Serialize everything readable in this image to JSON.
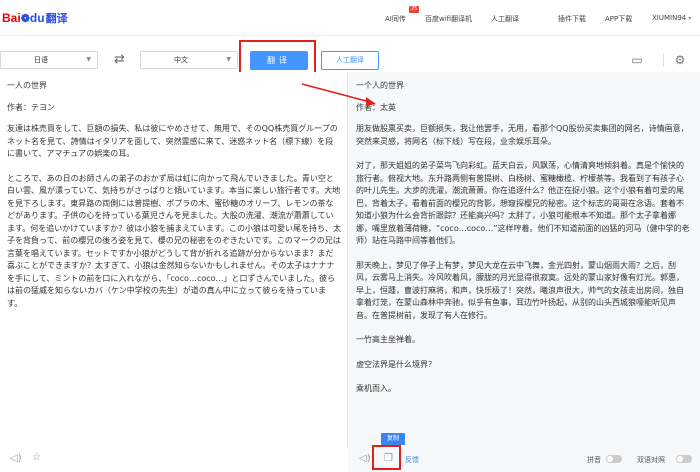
{
  "header": {
    "logo_bai": "Bai",
    "logo_du": "du",
    "logo_suffix": "翻译",
    "nav": [
      {
        "label": "AI同传"
      },
      {
        "label": "百度wifi翻译机"
      },
      {
        "label": "人工翻译"
      },
      {
        "label": "插件下载"
      },
      {
        "label": "APP下载"
      },
      {
        "label": "XIUMIN94"
      }
    ],
    "badge": "25"
  },
  "toolbar": {
    "source_lang": "日语",
    "target_lang": "中文",
    "translate_label": "翻译",
    "human_label": "人工翻译"
  },
  "source": {
    "paragraphs": [
      "一人の世界",
      "作者：テヨン",
      "友達は株売買をして、巨額の損失、私は彼にやめさせて、無用で、そのQQ株売買グループのネット名を見て、詩情はイタリアを面して、突然霊感に来て、迷惑ネット名（標下線）を段に書いて、アマチュアの娯楽の耳。",
      "ところで、あの日のお師さんの弟子のおかず局は虹に向かって飛んでいきました。青い空と白い雲、風が漂っていて、気持ちがさっぱりと傾いています。本当に楽しい旅行者です。大地を見下ろします。東昇路の両側には普提樹、ポプラの木、蜜砂糖のオリーブ、レモンの茶などがあります。子供の心を持っている葉児さんを見ました。大股の洗濯、潮流が蕭蕭しています。何を追いかけていますか？彼は小狼を捕まえています。この小狼は可愛い尾を持ち、太子を背負って、前の櫻兄の後ろ姿を見て、櫻の兄の秘密をのぞきたいです。このマークの兄は言葉を唱えています。セットですか小狼がどうして背が折れる追跡が分からないまま？まだ喜ぶことができますか？太すぎて、小狼は金然知らないかもしれません。その太子はナナナを手にして、ミントの前を口に入れながら、「coco…coco…」と口ずさんでいました。彼らは前の猛威を知らないカバ（ケン中学校の先生）が道の真ん中に立って彼らを待っています。"
    ]
  },
  "result": {
    "paragraphs": [
      "一个人的世界",
      "作者：太英",
      "朋友做股票买卖，巨额损失，我让他罢手，无用，看那个QQ股份买卖集团的网名，诗情画意，突然来灵感，将网名（标下线）写在段，业余娱乐耳朵。",
      "对了，那天姐姐的弟子菜鸟飞向彩虹。蓝天白云，风飘荡，心情清爽地倾斜着。真是个愉快的旅行者。俯视大地。东升路两侧有普提树、白杨树、蜜糖橄榄、柠檬茶等。我看到了有孩子心的叶儿先生。大步的洗濯，潮流萧萧。你在追逐什么？他正在捉小狼。这个小狼有着可爱的尾巴，背着太子，看着前面的樱兄的背影，想窥探樱兄的秘密。这个标志的哥哥在念语。套着不知道小狼为什么会背折跟踪？还能高兴吗？太胖了，小狼可能根本不知道。那个太子拿着娜娜，嘴里放着薄荷糖，“coco…coco…”这样哼着。他们不知道前面的凶猛的河马（健中学的老师）站在马路中间等着他们。",
      "那天晚上，梦见了停子上有梦，梦见大龙在云中飞舞，金光四射，蒙山烟雨大雨？之后，刮风，云雾马上消失。冷风吹着风，朦胧的月光显得很寂寞。远处的蒙山家好像有灯光。郭惠，早上，恒踵，曹波打麻将，和声，快乐极了！突然，曦浪声很大，帅气的女孩走出房间，独自拿着灯笼，在蒙山森林中奔驰，似乎有鱼事，耳边竹叶扬起，从别的山头西城狼嚎能听见声音。在普提树前，发现了有人在修行。",
      "一竹高主坐禅着。",
      "虚空法界是什么境界？",
      "乘机而入。",
      "智者"
    ]
  },
  "footer": {
    "copy_tip": "复制",
    "feedback_label": "反馈",
    "pinyin_label": "拼音",
    "bilingual_label": "双语对照"
  }
}
